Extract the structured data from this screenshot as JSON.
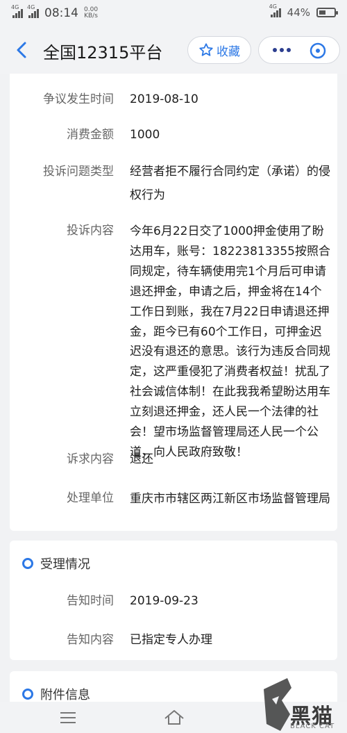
{
  "status_bar": {
    "network_1": "4G",
    "network_2": "4G",
    "time": "08:14",
    "speed_value": "0.00",
    "speed_unit": "KB/s",
    "right_network": "4G",
    "battery_percent": "44%",
    "battery_level": 0.44
  },
  "nav": {
    "title": "全国12315平台",
    "favorite_label": "收藏"
  },
  "details": [
    {
      "label": "争议发生时间",
      "value": "2019-08-10"
    },
    {
      "label": "消费金额",
      "value": "1000"
    },
    {
      "label": "投诉问题类型",
      "value": "经营者拒不履行合同约定（承诺）的侵权行为"
    },
    {
      "label": "投诉内容",
      "value": "今年6月22日交了1000押金使用了盼达用车，账号：18223813355按照合同规定，待车辆使用完1个月后可申请退还押金，申请之后，押金将在14个工作日到账，我在7月22日申请退还押金，距今已有60个工作日，可押金迟迟没有退还的意思。该行为违反合同规定，这严重侵犯了消费者权益！扰乱了社会诚信体制！在此我我希望盼达用车立刻退还押金，还人民一个法律的社会！望市场监督管理局还人民一个公道，向人民政府致敬！"
    },
    {
      "label": "诉求内容",
      "value": "退还"
    },
    {
      "label": "处理单位",
      "value": "重庆市市辖区两江新区市场监督管理局"
    }
  ],
  "acceptance": {
    "title": "受理情况",
    "rows": [
      {
        "label": "告知时间",
        "value": "2019-09-23"
      },
      {
        "label": "告知内容",
        "value": "已指定专人办理"
      }
    ]
  },
  "attachments": {
    "title": "附件信息"
  },
  "watermark": {
    "text": "黑猫",
    "sub": "BLACK CAT"
  },
  "colors": {
    "accent": "#2c78e6",
    "background": "#f1f2f4",
    "card": "#ffffff"
  }
}
